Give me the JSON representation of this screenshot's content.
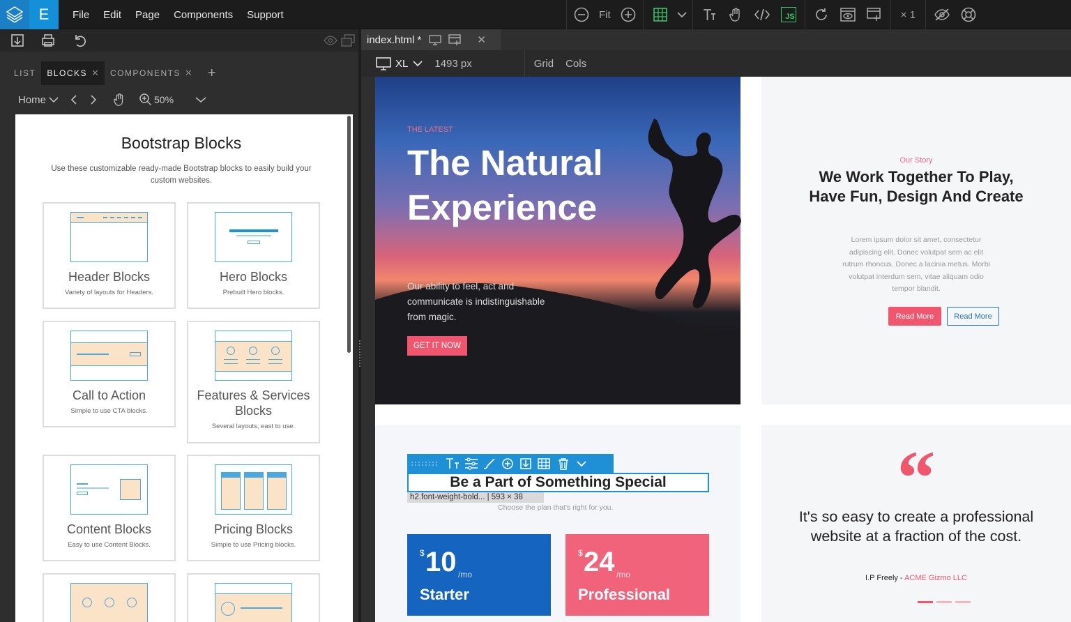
{
  "app": {
    "logo_letter": "E",
    "menu": [
      "File",
      "Edit",
      "Page",
      "Components",
      "Support"
    ]
  },
  "toolbar": {
    "fit_label": "Fit",
    "multiplier": "× 1",
    "js_label": "JS"
  },
  "left_panel": {
    "tabs": [
      {
        "label": "LIST",
        "closable": false,
        "active": false
      },
      {
        "label": "BLOCKS",
        "closable": true,
        "active": true
      },
      {
        "label": "COMPONENTS",
        "closable": true,
        "active": false
      }
    ],
    "add_tab": "+",
    "breadcrumb": "Home",
    "zoom": "50%",
    "library": {
      "title": "Bootstrap Blocks",
      "description": "Use these customizable ready-made Bootstrap blocks to easily build your custom websites.",
      "cards": [
        {
          "title": "Header Blocks",
          "desc": "Variety of layouts for Headers.",
          "thumb": "header"
        },
        {
          "title": "Hero Blocks",
          "desc": "Prebuilt Hero blocks.",
          "thumb": "hero"
        },
        {
          "title": "Call to Action",
          "desc": "Simple to use CTA blocks.",
          "thumb": "cta"
        },
        {
          "title": "Features & Services Blocks",
          "desc": "Several layouts, east to use.",
          "thumb": "features"
        },
        {
          "title": "Content Blocks",
          "desc": "Easy to use Content Blocks.",
          "thumb": "content"
        },
        {
          "title": "Pricing Blocks",
          "desc": "Simple to use Pricing blocks.",
          "thumb": "pricing"
        }
      ]
    }
  },
  "editor": {
    "file_tab": "index.html *",
    "device": "XL",
    "width": "1493 px",
    "grid_label": "Grid",
    "cols_label": "Cols"
  },
  "page": {
    "hero": {
      "eyebrow": "THE LATEST",
      "title": "The Natural Experience",
      "text": "Our ability to feel, act and communicate is indistinguishable from magic.",
      "cta": "GET IT NOW"
    },
    "story": {
      "eyebrow": "Our Story",
      "title": "We Work Together To Play, Have Fun, Design And Create",
      "text": "Lorem ipsum dolor sit amet, consectetur adipiscing elit. Donec volutpat sem ac elit rutrum rhoncus. Donec a lacinia metus. Morbi volutpat interdum sem, vitae aliquam odio tempor blandit.",
      "btn_primary": "Read More",
      "btn_outline": "Read More"
    },
    "pricing": {
      "selected_heading": "Be a Part of Something Special",
      "selection_info": "h2.font-weight-bold... | 593 × 38",
      "subtitle": "Choose the plan that's right for you.",
      "plans": [
        {
          "currency": "$",
          "amount": "10",
          "period": "/mo",
          "name": "Starter",
          "color": "#1565c0"
        },
        {
          "currency": "$",
          "amount": "24",
          "period": "/mo",
          "name": "Professional",
          "color": "#f0637a"
        }
      ]
    },
    "testimonial": {
      "quote_mark": "“",
      "quote": "It's so easy to create a professional website at a fraction of the cost.",
      "author": "I.P Freely - ",
      "company": "ACME Gizmo LLC"
    }
  },
  "colors": {
    "accent": "#1f8fd6",
    "brand_pink": "#f0566d",
    "brand_blue": "#1565c0"
  }
}
